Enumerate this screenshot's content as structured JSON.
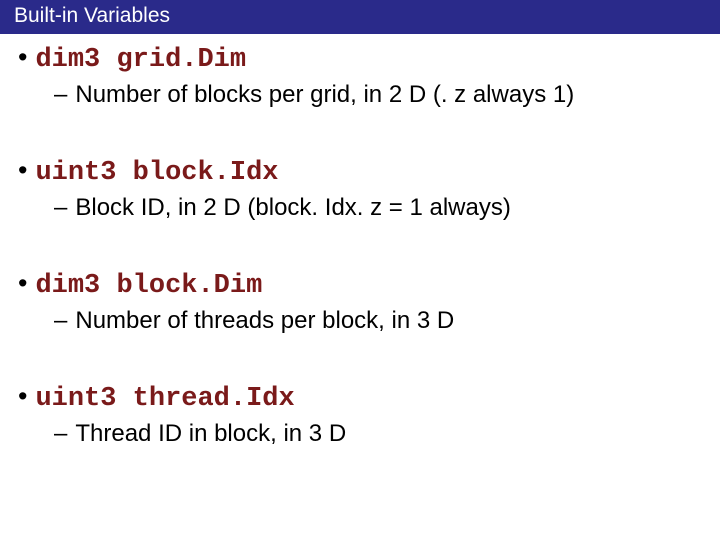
{
  "title": "Built-in Variables",
  "items": [
    {
      "code": "dim3 grid.Dim",
      "desc": "Number of blocks per grid, in 2 D (. z always 1)"
    },
    {
      "code": "uint3 block.Idx",
      "desc": "Block ID, in 2 D (block. Idx. z = 1 always)"
    },
    {
      "code": "dim3 block.Dim",
      "desc": "Number of threads per block, in 3 D"
    },
    {
      "code": "uint3 thread.Idx",
      "desc": "Thread ID in block, in 3 D"
    }
  ]
}
